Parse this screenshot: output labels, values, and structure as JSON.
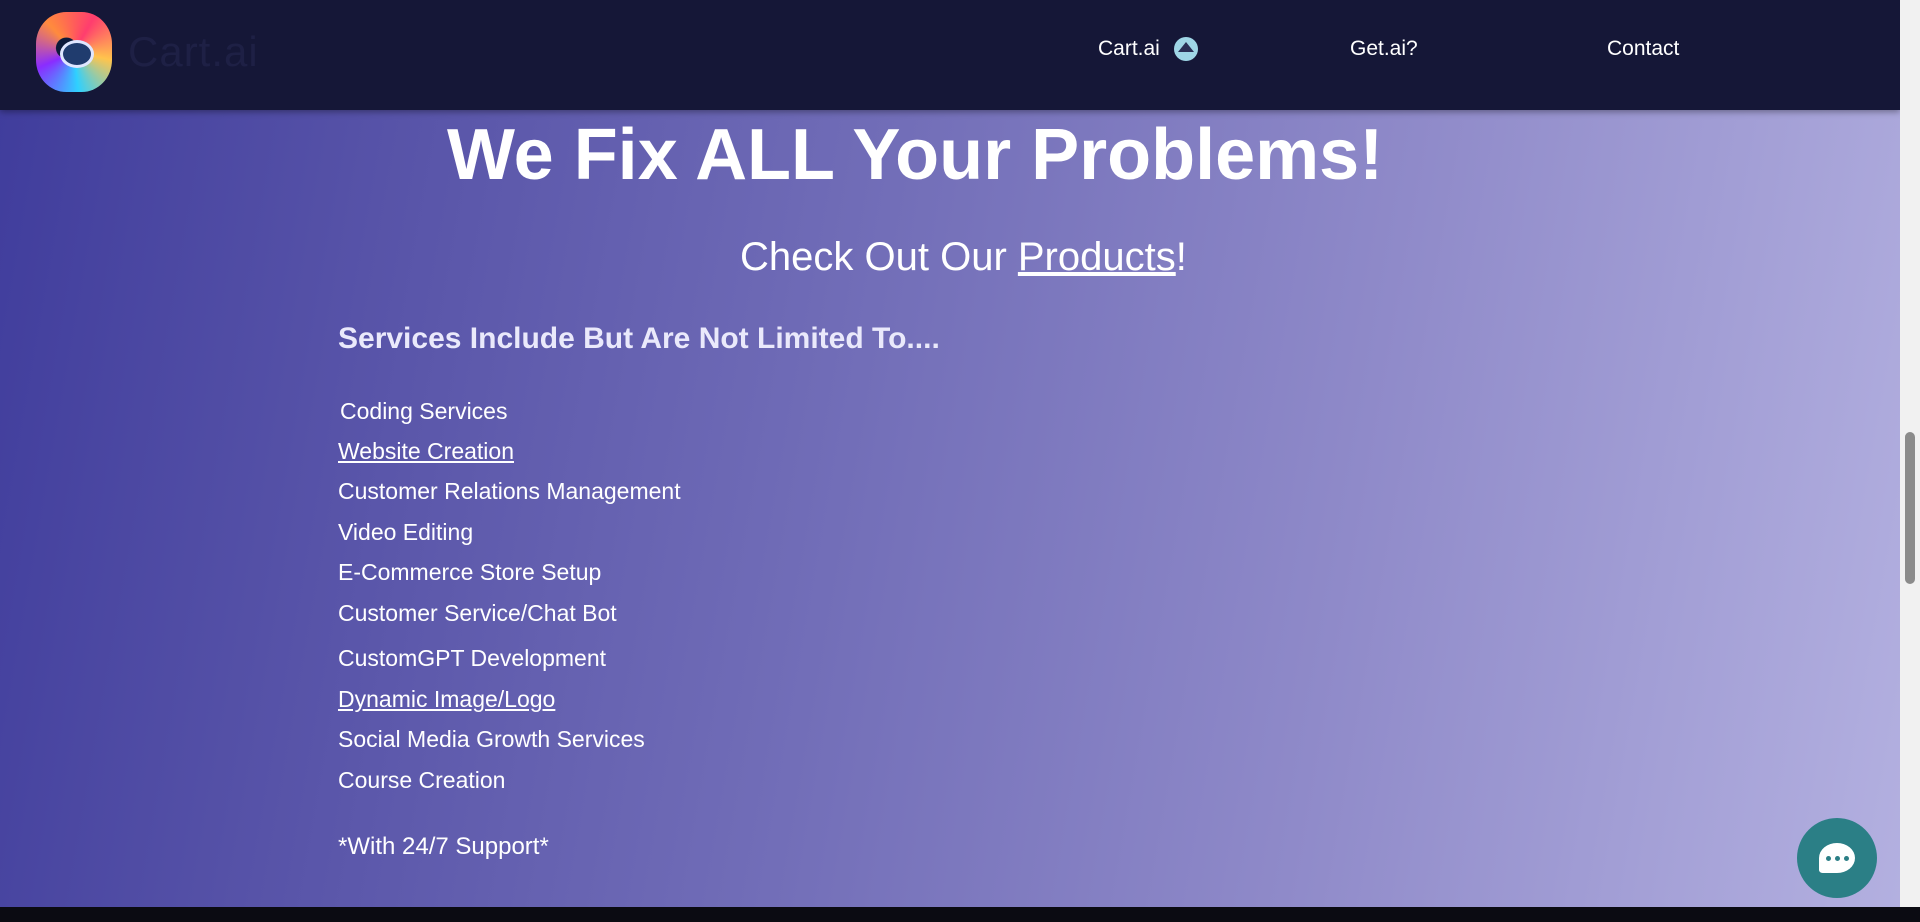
{
  "header": {
    "brand": "Cart.ai",
    "nav": {
      "cart": "Cart.ai",
      "get": "Get.ai?",
      "contact": "Contact"
    }
  },
  "main": {
    "headline": "We Fix ALL Your Problems!",
    "subhead_prefix": "Check Out Our ",
    "subhead_link": "Products",
    "subhead_suffix": "!",
    "services_title": "Services Include But Are Not Limited To....",
    "services": [
      "Coding Services",
      "Website Creation",
      "Customer Relations Management",
      "Video Editing",
      "E-Commerce Store Setup",
      "Customer Service/Chat Bot",
      "CustomGPT Development",
      "Dynamic Image/Logo",
      "Social Media Growth Services",
      "Course Creation"
    ],
    "support": "*With 24/7 Support*"
  },
  "icons": {
    "logo": "robot-logo-icon",
    "nav_caret": "caret-up-icon",
    "chat": "chat-bubble-icon"
  },
  "colors": {
    "header_bg": "#151737",
    "gradient_start": "#3f3c9c",
    "gradient_end": "#b3b0e0",
    "chat_button": "#2b7f86"
  }
}
